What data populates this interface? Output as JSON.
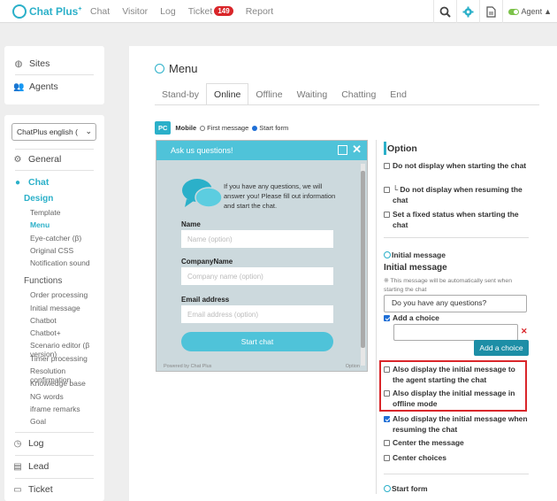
{
  "brand": {
    "name": "Chat Plus",
    "mark": "+"
  },
  "nav": {
    "items": [
      "Chat",
      "Visitor",
      "Log"
    ],
    "ticket_label": "Ticket",
    "ticket_count": "149",
    "report_label": "Report"
  },
  "topbar": {
    "agent_label": "Agent"
  },
  "sidebar": {
    "top": [
      {
        "icon": "globe-icon",
        "label": "Sites"
      },
      {
        "icon": "users-icon",
        "label": "Agents"
      }
    ],
    "site_select": "ChatPlus english (",
    "general": "General",
    "chat": "Chat",
    "design": "Design",
    "design_items": [
      "Template",
      "Menu",
      "Eye-catcher (β)",
      "Original CSS",
      "Notification sound"
    ],
    "functions": "Functions",
    "function_items": [
      "Order processing",
      "Initial message",
      "Chatbot",
      "Chatbot+",
      "Scenario editor (β version)",
      "Timer processing",
      "Resolution confirmation",
      "Knowledge base",
      "NG words",
      "iframe remarks",
      "Goal"
    ],
    "bottom": [
      {
        "icon": "clock-icon",
        "label": "Log"
      },
      {
        "icon": "lead-icon",
        "label": "Lead"
      },
      {
        "icon": "ticket-icon",
        "label": "Ticket"
      }
    ]
  },
  "page": {
    "title": "Menu"
  },
  "tabs": [
    "Stand-by",
    "Online",
    "Offline",
    "Waiting",
    "Chatting",
    "End"
  ],
  "device": {
    "pc": "PC",
    "mobile": "Mobile",
    "first_message": "First message",
    "start_form": "Start form"
  },
  "preview": {
    "header": "Ask us questions!",
    "intro": "If you have any questions, we will answer you! Please fill out information and start the chat.",
    "fields": [
      {
        "label": "Name",
        "placeholder": "Name (option)"
      },
      {
        "label": "CompanyName",
        "placeholder": "Company name (option)"
      },
      {
        "label": "Email address",
        "placeholder": "Email address (option)"
      }
    ],
    "start_button": "Start chat",
    "footer_left": "Powered by Chat Plus",
    "footer_right": "Option"
  },
  "options": {
    "heading": "Option",
    "do_not_display_start": "Do not display when starting the chat",
    "do_not_display_resume": "└ Do not display when resuming the chat",
    "fixed_status": "Set a fixed status when starting the chat",
    "initial_message_radio": "Initial message",
    "initial_message_heading": "Initial message",
    "initial_message_note": "※ This message will be automatically sent when starting the chat",
    "initial_message_value": "Do you have any questions?",
    "add_choice_label": "Add a choice",
    "add_choice_button": "Add a choice",
    "also_agent_start": "Also display the initial message to the agent starting the chat",
    "also_offline": "Also display the initial message in offline mode",
    "also_resuming": "Also display the initial message when resuming the chat",
    "center_message": "Center the message",
    "center_choices": "Center choices",
    "start_form": "Start form"
  },
  "colors": {
    "accent": "#2bb0c9",
    "highlight_box": "#d9262a",
    "ticket_badge": "#d9262a",
    "button": "#1d8ea6"
  }
}
